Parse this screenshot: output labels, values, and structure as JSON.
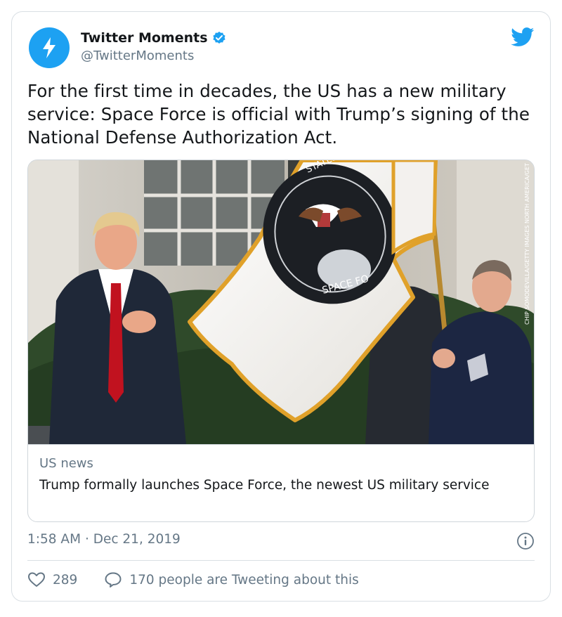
{
  "author": {
    "name": "Twitter Moments",
    "handle": "@TwitterMoments",
    "verified": true,
    "avatar_icon": "lightning-bolt-icon",
    "avatar_color": "#1da1f2"
  },
  "tweet": {
    "text": "For the first time in decades, the US has a new military service: Space Force is official with Trump’s signing of the National Defense Authorization Act."
  },
  "card": {
    "domain": "US news",
    "title": "Trump formally launches Space Force, the newest US military service",
    "image_credit": "CHIP SOMODEVILLA/GETTY IMAGES NORTH AMERICA/GETTY IMAGES",
    "flag_text": "SPACE FO",
    "flag_text_top": "STATES"
  },
  "meta": {
    "time": "1:58 AM",
    "separator": "·",
    "date": "Dec 21, 2019"
  },
  "actions": {
    "likes": "289",
    "replies_text": "170 people are Tweeting about this"
  },
  "colors": {
    "brand": "#1da1f2",
    "secondary_text": "#657786",
    "border": "#d9dfe4"
  }
}
